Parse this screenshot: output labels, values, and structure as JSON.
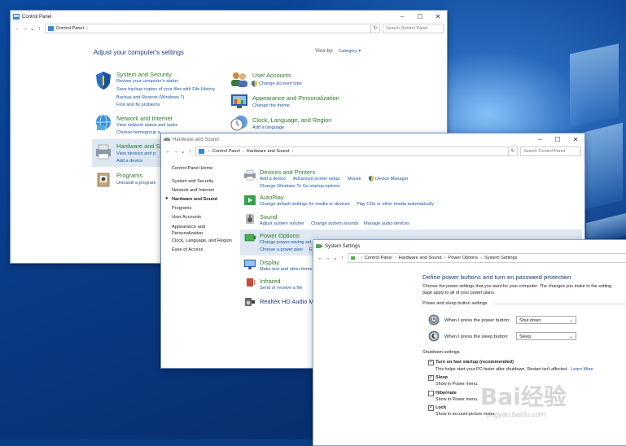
{
  "cp": {
    "title": "Control Panel",
    "crumb": "Control Panel",
    "search_placeholder": "Search Control Panel",
    "heading": "Adjust your computer's settings",
    "viewby_label": "View by:",
    "viewby_value": "Category",
    "categories": [
      {
        "title": "System and Security",
        "links": [
          "Review your computer's status",
          "Save backup copies of your files with File History",
          "Backup and Restore (Windows 7)",
          "Find and fix problems"
        ]
      },
      {
        "title": "Network and Internet",
        "links": [
          "View network status and tasks",
          "Choose homegroup a"
        ]
      },
      {
        "title": "Hardware and S",
        "links": [
          "View devices and p",
          "Add a device"
        ]
      },
      {
        "title": "Programs",
        "links": [
          "Uninstall a program"
        ]
      },
      {
        "title": "User Accounts",
        "links": [
          "Change account type"
        ]
      },
      {
        "title": "Appearance and Personalization",
        "links": [
          "Change the theme"
        ]
      },
      {
        "title": "Clock, Language, and Region",
        "links": [
          "Add a language"
        ]
      }
    ]
  },
  "hs": {
    "title": "Hardware and Sound",
    "crumbs": [
      "Control Panel",
      "Hardware and Sound"
    ],
    "search_placeholder": "Search Control Panel",
    "sidebar": [
      "Control Panel Home",
      "System and Security",
      "Network and Internet",
      "Hardware and Sound",
      "Programs",
      "User Accounts",
      "Appearance and Personalization",
      "Clock, Language, and Region",
      "Ease of Access"
    ],
    "items": [
      {
        "title": "Devices and Printers",
        "links": [
          "Add a device",
          "Advanced printer setup",
          "Mouse",
          "Device Manager",
          "Change Windows To Go startup options"
        ]
      },
      {
        "title": "AutoPlay",
        "links": [
          "Change default settings for media or devices",
          "Play CDs or other media automatically"
        ]
      },
      {
        "title": "Sound",
        "links": [
          "Adjust system volume",
          "Change system sounds",
          "Manage audio devices"
        ]
      },
      {
        "title": "Power Options",
        "links": [
          "Change power-saving set",
          "Choose a power plan",
          "E"
        ]
      },
      {
        "title": "Display",
        "links": [
          "Make text and other items"
        ]
      },
      {
        "title": "Infrared",
        "links": [
          "Send or receive a file"
        ]
      },
      {
        "title": "Realtek HD Audio M",
        "links": []
      }
    ]
  },
  "ss": {
    "title": "System Settings",
    "crumbs": [
      "Control Panel",
      "Hardware and Sound",
      "Power Options",
      "System Settings"
    ],
    "heading": "Define power buttons and turn on password protection",
    "desc1": "Choose the power settings that you want for your computer. The changes you make to the setting",
    "desc2": "page apply to all of your power plans.",
    "section1": "Power and sleep button settings",
    "power_label": "When I press the power button:",
    "power_value": "Shut down",
    "sleep_label": "When I press the sleep button:",
    "sleep_value": "Sleep",
    "section2": "Shutdown settings",
    "checks": [
      {
        "label": "Turn on fast startup (recommended)",
        "desc": "This helps start your PC faster after shutdown. Restart isn't affected.",
        "link": "Learn More",
        "checked": true
      },
      {
        "label": "Sleep",
        "desc": "Show in Power menu.",
        "checked": true
      },
      {
        "label": "Hibernate",
        "desc": "Show in Power menu.",
        "checked": false
      },
      {
        "label": "Lock",
        "desc": "Show in account picture menu.",
        "checked": true
      }
    ]
  },
  "watermark": {
    "brand": "Bai经验",
    "url": "jingyan.baidu.com"
  }
}
